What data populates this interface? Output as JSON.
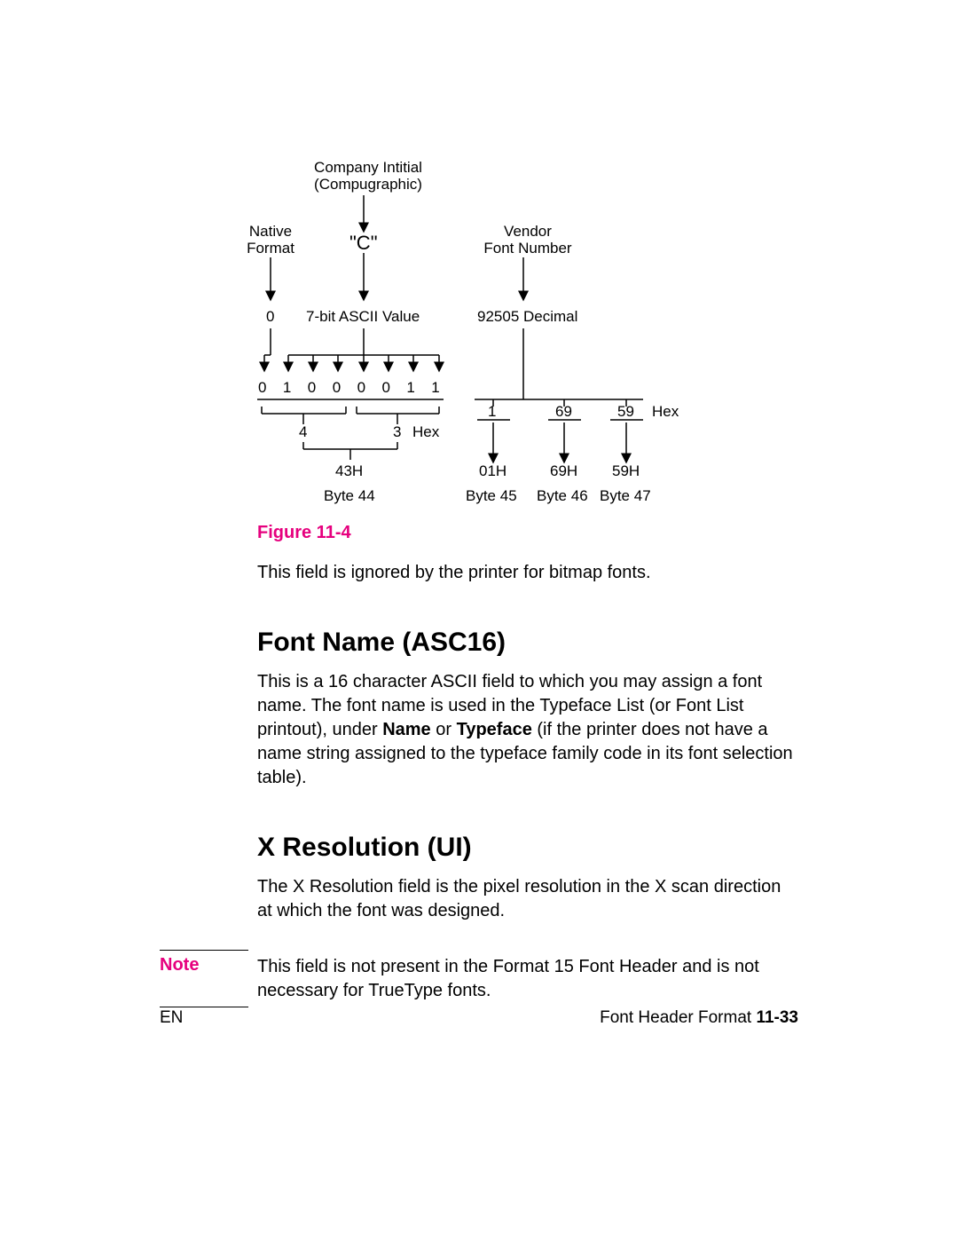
{
  "diagram": {
    "companyInitial1": "Company Intitial",
    "companyInitial2": "(Compugraphic)",
    "nativeFormat1": "Native",
    "nativeFormat2": "Format",
    "c": "\"C\"",
    "vendor1": "Vendor",
    "vendor2": "Font Number",
    "zero": "0",
    "ascii": "7-bit ASCII Value",
    "decimal": "92505 Decimal",
    "bits": "0  1  0  0  0  0  1  1",
    "hex4": "4",
    "hex3": "3",
    "hexLabel": "Hex",
    "h43": "43H",
    "byte44": "Byte 44",
    "r1": "1",
    "r69": "69",
    "r59": "59",
    "rHex": "Hex",
    "h01": "01H",
    "h69": "69H",
    "h59": "59H",
    "byte45": "Byte 45",
    "byte46": "Byte 46",
    "byte47": "Byte 47"
  },
  "figureCaption": "Figure 11-4",
  "para1": "This field is ignored by the printer for bitmap fonts.",
  "heading1": "Font Name (ASC16)",
  "para2a": "This is a 16 character ASCII field to which you may assign a font name. The font name is used in the Typeface List (or Font List printout), under ",
  "para2b": "Name",
  "para2c": " or ",
  "para2d": "Typeface",
  "para2e": " (if the printer does not have a name string assigned to the typeface family code in its font selection table).",
  "heading2": "X Resolution (UI)",
  "para3": "The X Resolution field is the pixel resolution in the X scan direction at which the font was designed.",
  "noteLabel": "Note",
  "noteText": "This field is not present in the Format 15 Font Header and is not necessary for TrueType fonts.",
  "footerLeft": "EN",
  "footerRightText": "Font Header Format ",
  "footerRightPage": "11-33"
}
